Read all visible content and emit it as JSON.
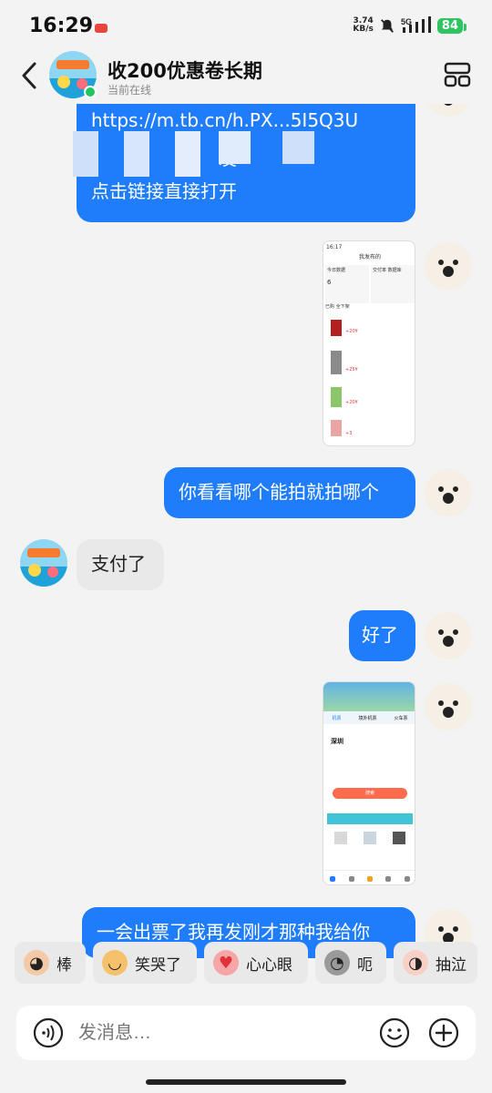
{
  "status": {
    "time": "16:29",
    "net_speed_value": "3.74",
    "net_speed_unit": "KB/s",
    "network": "5G",
    "battery": "84"
  },
  "header": {
    "contact_name": "收200优惠卷长期",
    "contact_status": "当前在线"
  },
  "messages": [
    {
      "id": "m1",
      "side": "out",
      "lines": [
        "https://m.tb.cn/h.PX...5I5Q3U",
        "                      发",
        "点击链接直接打开"
      ]
    },
    {
      "id": "m2",
      "side": "out",
      "type": "image",
      "icon": "screenshot-thumbnail"
    },
    {
      "id": "m3",
      "side": "out",
      "text": "你看看哪个能拍就拍哪个"
    },
    {
      "id": "m4",
      "side": "in",
      "text": "支付了"
    },
    {
      "id": "m5",
      "side": "out",
      "text": "好了"
    },
    {
      "id": "m6",
      "side": "out",
      "type": "image",
      "icon": "ticket-app-thumbnail"
    },
    {
      "id": "m7",
      "side": "out",
      "text": "一会出票了我再发刚才那种我给你"
    }
  ],
  "thumb1": {
    "time": "16:17",
    "title": "我发布的",
    "tab1": "今日数据",
    "tab2": "交付率 数据库",
    "num": "6",
    "list_label": "已购 全下架",
    "item1_price": "+20¥",
    "item2_price": "+25¥",
    "item3_price": "+20¥",
    "item4_price": "+3"
  },
  "thumb2": {
    "tab1": "机票",
    "tab2": "境外机票",
    "tab3": "火车票",
    "from": "深圳",
    "btn": "搜索"
  },
  "quick_replies": [
    {
      "label": "棒",
      "icon": "cat-face-icon",
      "color": "#f3c9a6"
    },
    {
      "label": "笑哭了",
      "icon": "laughing-dog-icon",
      "color": "#f6c16b"
    },
    {
      "label": "心心眼",
      "icon": "heart-eyes-icon",
      "color": "#f6a6a6"
    },
    {
      "label": "呃",
      "icon": "gray-cat-icon",
      "color": "#9a9a9a"
    },
    {
      "label": "抽泣",
      "icon": "crying-cat-icon",
      "color": "#f8d0c6"
    }
  ],
  "input": {
    "placeholder": "发消息…"
  }
}
